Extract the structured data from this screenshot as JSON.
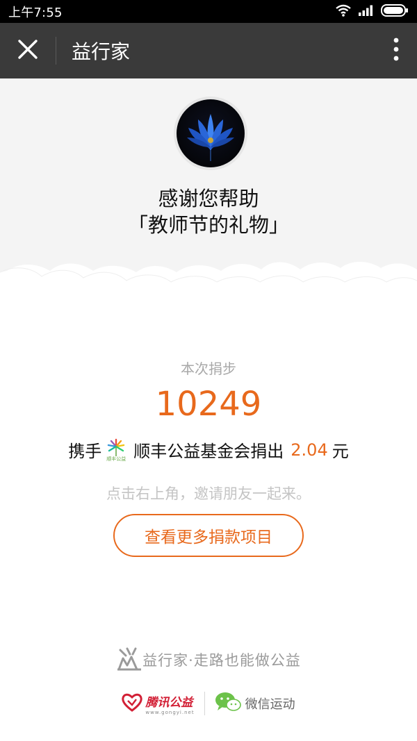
{
  "status_bar": {
    "time": "上午7:55"
  },
  "header": {
    "title": "益行家"
  },
  "hero": {
    "thanks_line1": "感谢您帮助",
    "thanks_line2": "「教师节的礼物」"
  },
  "main": {
    "steps_label": "本次捐步",
    "steps_value": "10249",
    "donate_prefix": "携手",
    "foundation_name": "顺丰公益基金会捐出",
    "amount": "2.04",
    "currency": "元",
    "sf_logo_text": "顺丰公益",
    "invite_text": "点击右上角，邀请朋友一起来。",
    "more_projects_button": "查看更多捐款项目"
  },
  "footer": {
    "slogan": "益行家·走路也能做公益",
    "tencent_name": "腾讯公益",
    "tencent_url": "www.gongyi.net",
    "wechat_name": "微信运动"
  },
  "colors": {
    "accent": "#e8691c",
    "header_bg": "#3a3a3a",
    "hero_bg": "#f4f4f4"
  }
}
